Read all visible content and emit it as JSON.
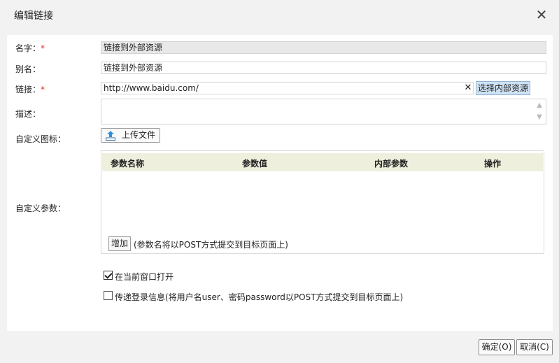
{
  "dialog": {
    "title": "编辑链接",
    "close_glyph": "✕"
  },
  "form": {
    "name": {
      "label": "名字：",
      "required_mark": "*",
      "value": "链接到外部资源"
    },
    "alias": {
      "label": "别名：",
      "value": "链接到外部资源"
    },
    "link": {
      "label": "链接：",
      "required_mark": "*",
      "value": "http://www.baidu.com/",
      "clear_glyph": "✕",
      "pick_button": "选择内部资源"
    },
    "description": {
      "label": "描述：",
      "value": ""
    },
    "icon": {
      "label": "自定义图标：",
      "upload_button": "上传文件"
    },
    "params": {
      "label": "自定义参数：",
      "columns": [
        "参数名称",
        "参数值",
        "内部参数",
        "操作"
      ],
      "rows": [],
      "add_button": "增加",
      "hint": "(参数名将以POST方式提交到目标页面上)"
    },
    "open_in_current": {
      "label": "在当前窗口打开",
      "checked": true
    },
    "pass_login": {
      "label": "传递登录信息(将用户名user、密码password以POST方式提交到目标页面上)",
      "checked": false
    }
  },
  "footer": {
    "ok": "确定(O)",
    "cancel": "取消(C)"
  },
  "colors": {
    "required": "#d93025",
    "pick_button_bg": "#cfe3f5",
    "table_header_bg": "#efefde"
  }
}
